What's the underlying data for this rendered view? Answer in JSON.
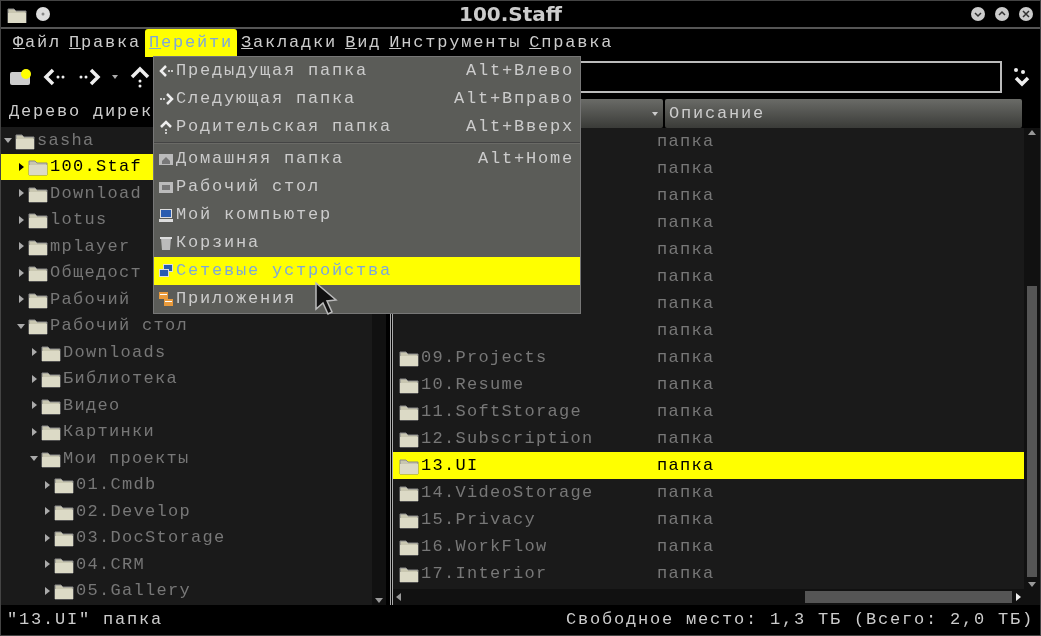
{
  "window": {
    "title": "100.Staff"
  },
  "menubar": [
    {
      "label": "Файл",
      "selected": false
    },
    {
      "label": "Правка",
      "selected": false
    },
    {
      "label": "Перейти",
      "selected": true
    },
    {
      "label": "Закладки",
      "selected": false
    },
    {
      "label": "Вид",
      "selected": false
    },
    {
      "label": "Инструменты",
      "selected": false
    },
    {
      "label": "Справка",
      "selected": false
    }
  ],
  "go_menu": [
    {
      "kind": "item",
      "label": "Предыдущая папка",
      "shortcut": "Alt+Влево",
      "selected": false
    },
    {
      "kind": "item",
      "label": "Следующая папка",
      "shortcut": "Alt+Вправо",
      "selected": false
    },
    {
      "kind": "item",
      "label": "Родительская папка",
      "shortcut": "Alt+Вверх",
      "selected": false
    },
    {
      "kind": "separator"
    },
    {
      "kind": "item",
      "label": "Домашняя папка",
      "shortcut": "Alt+Home",
      "selected": false
    },
    {
      "kind": "item",
      "label": "Рабочий стол",
      "selected": false
    },
    {
      "kind": "item",
      "label": "Мой компьютер",
      "selected": false
    },
    {
      "kind": "item",
      "label": "Корзина",
      "selected": false
    },
    {
      "kind": "item",
      "label": "Сетевые устройства",
      "selected": true
    },
    {
      "kind": "item",
      "label": "Приложения",
      "selected": false
    }
  ],
  "tree": {
    "header": "Дерево дирек",
    "items": [
      {
        "label": "sasha",
        "expanded": true,
        "selected": false,
        "children": [
          {
            "label": "100.Staf",
            "expanded": false,
            "selected": true
          },
          {
            "label": "Download",
            "expanded": false,
            "selected": false
          },
          {
            "label": "lotus",
            "expanded": false,
            "selected": false
          },
          {
            "label": "mplayer",
            "expanded": false,
            "selected": false
          },
          {
            "label": "Общедост",
            "expanded": false,
            "selected": false
          },
          {
            "label": "Рабочий",
            "expanded": false,
            "selected": false
          },
          {
            "label": "Рабочий стол",
            "expanded": true,
            "selected": false,
            "children": [
              {
                "label": "Downloads",
                "expanded": false,
                "selected": false
              },
              {
                "label": "Библиотека",
                "expanded": false,
                "selected": false
              },
              {
                "label": "Видео",
                "expanded": false,
                "selected": false
              },
              {
                "label": "Картинки",
                "expanded": false,
                "selected": false
              },
              {
                "label": "Мои проекты",
                "expanded": true,
                "selected": false,
                "children": [
                  {
                    "label": "01.Cmdb",
                    "expanded": false,
                    "selected": false
                  },
                  {
                    "label": "02.Develop",
                    "expanded": false,
                    "selected": false
                  },
                  {
                    "label": "03.DocStorage",
                    "expanded": false,
                    "selected": false
                  },
                  {
                    "label": "04.CRM",
                    "expanded": false,
                    "selected": false
                  },
                  {
                    "label": "05.Gallery",
                    "expanded": false,
                    "selected": false
                  }
                ]
              }
            ]
          }
        ]
      }
    ]
  },
  "file_list": {
    "columns": [
      "Описание"
    ],
    "rows": [
      {
        "description": "папка",
        "selected": false
      },
      {
        "description": "папка",
        "selected": false
      },
      {
        "description": "папка",
        "selected": false
      },
      {
        "description": "папка",
        "selected": false
      },
      {
        "description": "папка",
        "selected": false
      },
      {
        "description": "папка",
        "selected": false
      },
      {
        "description": "папка",
        "selected": false
      },
      {
        "description": "папка",
        "selected": false
      },
      {
        "name": "09.Projects",
        "description": "папка",
        "selected": false
      },
      {
        "name": "10.Resume",
        "description": "папка",
        "selected": false
      },
      {
        "name": "11.SoftStorage",
        "description": "папка",
        "selected": false
      },
      {
        "name": "12.Subscription",
        "description": "папка",
        "selected": false
      },
      {
        "name": "13.UI",
        "description": "папка",
        "selected": true
      },
      {
        "name": "14.VideoStorage",
        "description": "папка",
        "selected": false
      },
      {
        "name": "15.Privacy",
        "description": "папка",
        "selected": false
      },
      {
        "name": "16.WorkFlow",
        "description": "папка",
        "selected": false
      },
      {
        "name": "17.Interior",
        "description": "папка",
        "selected": false
      }
    ]
  },
  "status_bar": {
    "left": "\"13.UI\" папка",
    "right": "Свободное место: 1,3 ТБ (Всего: 2,0 ТБ)"
  }
}
